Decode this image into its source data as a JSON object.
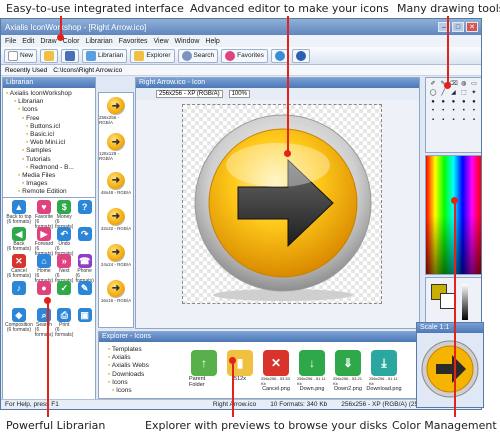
{
  "callouts": {
    "top_left": "Easy-to-use integrated interface",
    "top_center": "Advanced editor to make your icons",
    "top_right": "Many drawing tools",
    "bottom_left": "Powerful Librarian",
    "bottom_center": "Explorer with previews to browse your disks",
    "bottom_right": "Color Management"
  },
  "window": {
    "title": "Axialis IconWorkshop - [Right Arrow.ico]"
  },
  "menu": [
    "File",
    "Edit",
    "Draw",
    "Color",
    "Librarian",
    "Favorites",
    "View",
    "Window",
    "Help"
  ],
  "toolbar": {
    "new_label": "New",
    "librarian_label": "Librarian",
    "explorer_label": "Explorer",
    "search_label": "Search",
    "favorites_label": "Favorites"
  },
  "address": {
    "recent_label": "Recently Used",
    "path": "C:\\Icons\\Right Arrow.ico"
  },
  "librarian": {
    "title": "Librarian",
    "tree": [
      "Axialis IconWorkshop",
      "Librarian",
      "Icons",
      "Free",
      "Buttons.icl",
      "Basic.icl",
      "Web Mini.icl",
      "Samples",
      "Tutorials",
      "Redmond - B...",
      "Media Files",
      "Images",
      "Remote Edition"
    ],
    "items": [
      {
        "label": "Back to top",
        "sub": "(6 formats)",
        "color": "#2b86d8",
        "glyph": "▲"
      },
      {
        "label": "Favorite",
        "sub": "(6 formats)",
        "color": "#e0427f",
        "glyph": "♥"
      },
      {
        "label": "Money",
        "sub": "(6 formats)",
        "color": "#2fa84a",
        "glyph": "$"
      },
      {
        "label": "",
        "sub": "",
        "color": "#2b86d8",
        "glyph": "?"
      },
      {
        "label": "Back",
        "sub": "(6 formats)",
        "color": "#2fa84a",
        "glyph": "◀"
      },
      {
        "label": "Forward",
        "sub": "(6 formats)",
        "color": "#e0427f",
        "glyph": "▶"
      },
      {
        "label": "Undo",
        "sub": "(6 formats)",
        "color": "#2b86d8",
        "glyph": "↶"
      },
      {
        "label": "",
        "sub": "",
        "color": "#2b86d8",
        "glyph": "↷"
      },
      {
        "label": "Cancel",
        "sub": "(6 formats)",
        "color": "#d9342b",
        "glyph": "✕"
      },
      {
        "label": "Home",
        "sub": "(6 formats)",
        "color": "#2b86d8",
        "glyph": "⌂"
      },
      {
        "label": "Next",
        "sub": "(6 formats)",
        "color": "#e0427f",
        "glyph": "»"
      },
      {
        "label": "Phone",
        "sub": "(6 formats)",
        "color": "#8a3fc6",
        "glyph": "☎"
      },
      {
        "label": "",
        "sub": "",
        "color": "#2b86d8",
        "glyph": "♪"
      },
      {
        "label": "",
        "sub": "",
        "color": "#e0427f",
        "glyph": "●"
      },
      {
        "label": "",
        "sub": "",
        "color": "#2fa84a",
        "glyph": "✓"
      },
      {
        "label": "",
        "sub": "",
        "color": "#2b86d8",
        "glyph": "✎"
      },
      {
        "label": "Composition",
        "sub": "(6 formats)",
        "color": "#2b86d8",
        "glyph": "◆"
      },
      {
        "label": "Search",
        "sub": "(6 formats)",
        "color": "#2b86d8",
        "glyph": "⌕"
      },
      {
        "label": "Print",
        "sub": "(6 formats)",
        "color": "#2b86d8",
        "glyph": "⎙"
      },
      {
        "label": "",
        "sub": "",
        "color": "#2b86d8",
        "glyph": "▣"
      }
    ]
  },
  "thumbs": [
    "256x256 - RGB/A",
    "128x128 - RGB/A",
    "48x48 - RGB/A",
    "32x32 - RGB/A",
    "24x24 - RGB/A",
    "16x16 - RGB/A"
  ],
  "editor": {
    "title": "Right Arrow.ico - Icon",
    "format": "256x256 - XP (RGB/A)",
    "zoom": "100%"
  },
  "explorer": {
    "title": "Explorer - Icons",
    "tree": [
      "Templates",
      "Axialis",
      "Axialis Webs",
      "Downloads",
      "Icons",
      "Icons"
    ],
    "files": [
      {
        "name": "Parent Folder",
        "info": "",
        "color": "#58b04a",
        "glyph": "↑"
      },
      {
        "name": "512x",
        "info": "",
        "color": "#f0c040",
        "glyph": "▮"
      },
      {
        "name": "Cancel.png",
        "info": "256x256 - 53.53 Kb",
        "color": "#d9342b",
        "glyph": "✕"
      },
      {
        "name": "Down.png",
        "info": "256x256 - 51.11 Kb",
        "color": "#2fa84a",
        "glyph": "↓"
      },
      {
        "name": "Down2.png",
        "info": "256x256 - 53.21 Kb",
        "color": "#2fa84a",
        "glyph": "⇓"
      },
      {
        "name": "Download.png",
        "info": "256x256 - 51.11 Kb",
        "color": "#2aa8a0",
        "glyph": "⤓"
      }
    ]
  },
  "scale_panel": {
    "title": "Scale 1:1"
  },
  "status": {
    "help": "For Help, press F1",
    "file": "Right Arrow.ico",
    "formats": "10 Formats: 340 Kb",
    "format": "256x256 - XP (RGB/A) (256 c...)",
    "size": "256x256"
  },
  "colors": {
    "accent": "#e2231a",
    "arrow_yellow": "#f5b400",
    "window_blue": "#5f86bd"
  }
}
